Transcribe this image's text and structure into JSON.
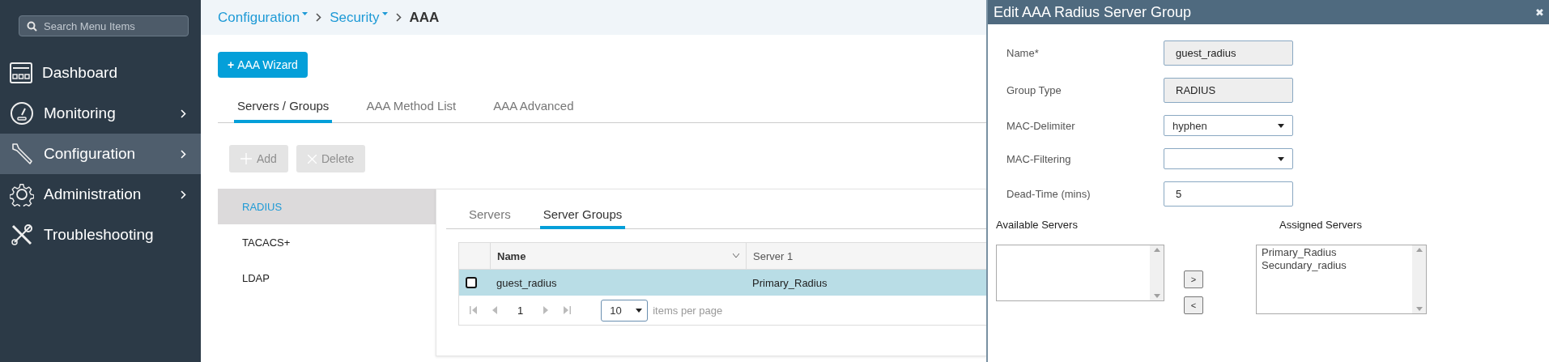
{
  "sidebar": {
    "search": {
      "placeholder": "Search Menu Items"
    },
    "items": [
      {
        "label": "Dashboard",
        "kind": "dashboard",
        "selected": false,
        "has_submenu": false
      },
      {
        "label": "Monitoring",
        "kind": "monitoring",
        "selected": false,
        "has_submenu": true
      },
      {
        "label": "Configuration",
        "kind": "configuration",
        "selected": true,
        "has_submenu": true
      },
      {
        "label": "Administration",
        "kind": "administration",
        "selected": false,
        "has_submenu": true
      },
      {
        "label": "Troubleshooting",
        "kind": "troubleshooting",
        "selected": false,
        "has_submenu": false
      }
    ]
  },
  "breadcrumb": [
    {
      "label": "Configuration",
      "dropdown": true
    },
    {
      "label": "Security",
      "dropdown": true
    },
    {
      "label": "AAA",
      "dropdown": false
    }
  ],
  "wizard_button": {
    "icon": "+",
    "label": "AAA Wizard"
  },
  "tabs": [
    {
      "label": "Servers / Groups",
      "selected": true
    },
    {
      "label": "AAA Method List",
      "selected": false
    },
    {
      "label": "AAA Advanced",
      "selected": false
    }
  ],
  "actions": [
    {
      "kind": "add",
      "label": "Add",
      "disabled": true
    },
    {
      "kind": "delete",
      "label": "Delete",
      "disabled": true
    }
  ],
  "protocols": [
    {
      "label": "RADIUS",
      "selected": true
    },
    {
      "label": "TACACS+",
      "selected": false
    },
    {
      "label": "LDAP",
      "selected": false
    }
  ],
  "sub_tabs": [
    {
      "label": "Servers",
      "selected": false
    },
    {
      "label": "Server Groups",
      "selected": true
    }
  ],
  "table": {
    "columns": [
      "Name",
      "Server 1"
    ],
    "rows": [
      {
        "name": "guest_radius",
        "server_1": "Primary_Radius",
        "selected": true,
        "checked": false
      }
    ],
    "pager": {
      "page": "1",
      "page_size": "10",
      "per_page_label": "items per page"
    }
  },
  "dialog": {
    "title": "Edit AAA Radius Server Group",
    "close": "✖",
    "fields": [
      {
        "kind": "readonly",
        "label": "Name*",
        "value": "guest_radius"
      },
      {
        "kind": "readonly",
        "label": "Group Type",
        "value": "RADIUS"
      },
      {
        "kind": "select",
        "label": "MAC-Delimiter",
        "value": "hyphen"
      },
      {
        "kind": "select",
        "label": "MAC-Filtering"
      },
      {
        "kind": "text",
        "label": "Dead-Time (mins)",
        "value": "5"
      }
    ],
    "available_servers": {
      "label": "Available Servers"
    },
    "move_buttons": [
      ">",
      "<"
    ],
    "assigned_servers": {
      "label": "Assigned Servers",
      "items": [
        "Primary_Radius",
        "Secundary_radius"
      ]
    }
  }
}
